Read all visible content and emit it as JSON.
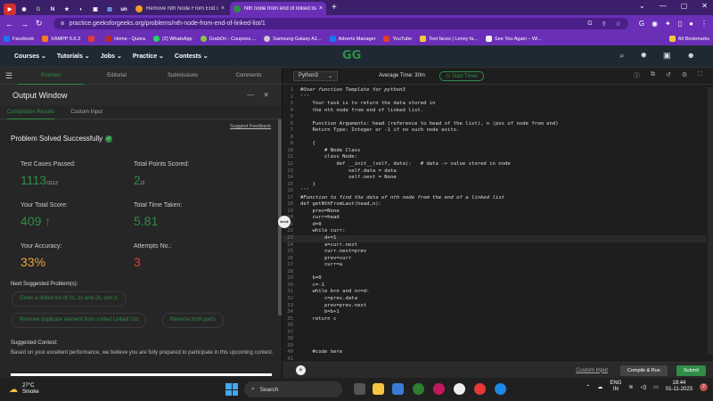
{
  "browser": {
    "tabs": [
      {
        "title": "Remove Nth Node From End of",
        "active": false
      },
      {
        "title": "Nth node from end of linked list",
        "active": true
      }
    ],
    "pinned_icons": [
      "youtube-icon",
      "chrome-icon",
      "gfg-icon",
      "unacademy-icon",
      "bookmark-icon",
      "github-icon",
      "notion-icon",
      "docs-icon",
      "unstop-icon"
    ],
    "url": "practice.geeksforgeeks.org/problems/nth-node-from-end-of-linked-list/1",
    "bookmarks": [
      "Facebook",
      "XAMPP 5.6.3",
      "",
      "Home - Quora",
      "(2) WhatsApp",
      "GrabOn - Coupons,...",
      "Samsung Galaxy A1...",
      "Adverts Manager",
      "YouTube",
      "Text faces | Lenny fa...",
      "See You Again – Wi..."
    ],
    "all_bookmarks": "All Bookmarks"
  },
  "site": {
    "menu": [
      "Courses ⌄",
      "Tutorials ⌄",
      "Jobs ⌄",
      "Practice ⌄",
      "Contests ⌄"
    ],
    "logo": "GG"
  },
  "left_tabs": [
    "Problem",
    "Editorial",
    "Submissions",
    "Comments"
  ],
  "output": {
    "title": "Output Window",
    "tabs": [
      "Compilation Results",
      "Custom Input"
    ],
    "feedback": "Suggest Feedback",
    "status": "Problem Solved Successfully",
    "stats": {
      "tcp_label": "Test Cases Passed:",
      "tcp_value": "1113",
      "tcp_total": "/1113",
      "tps_label": "Total Points Scored:",
      "tps_value": "2",
      "tps_total": "/2",
      "score_label": "Your Total Score:",
      "score_value": "409",
      "time_label": "Total Time Taken:",
      "time_value": "5.81",
      "acc_label": "Your Accuracy:",
      "acc_value": "33%",
      "att_label": "Attempts No.:",
      "att_value": "3"
    },
    "next_label": "Next Suggested Problem(s):",
    "next_problems": [
      "Given a linked list of 0s, 1s and 2s, sort it.",
      "Remove duplicate element from sorted Linked List",
      "Reverse both parts"
    ],
    "contest_heading": "Suggested Contest:",
    "contest_text": "Based on your excellent performance, we believe you are fully prepared to participate in this upcoming contest."
  },
  "editor": {
    "language": "Python3",
    "avg_time": "Average Time: 30m",
    "timer": "Start Timer",
    "code": [
      "#User function Template for python3",
      "'''",
      "    Your task is to return the data stored in",
      "    the nth node from end of linked list.",
      "",
      "    Function Arguments: head (reference to head of the list), n (pos of node from end)",
      "    Return Type: Integer or -1 if no such node exits.",
      "",
      "    {",
      "        # Node Class",
      "        class Node:",
      "            def __init__(self, data):   # data -> value stored in node",
      "                self.data = data",
      "                self.next = None",
      "    }",
      "'''",
      "#Function to find the data of nth node from the end of a linked list",
      "def getNthFromLast(head,n):",
      "    prev=None",
      "    curr=head",
      "    d=0",
      "    while curr:",
      "        d+=1",
      "        a=curr.next",
      "        curr.next=prev",
      "        prev=curr",
      "        curr=a",
      "",
      "    b=0",
      "    c=-1",
      "    while b<n and n<=d:",
      "        c=prev.data",
      "        prev=prev.next",
      "        b=b+1",
      "    return c",
      "",
      "",
      "",
      "",
      "    #code here",
      ""
    ],
    "line_numbers": [
      "1",
      "2",
      "3",
      "4",
      "5",
      "6",
      "7",
      "8",
      "9",
      "10",
      "11",
      "12",
      "13",
      "14",
      "15",
      "16",
      "17",
      "18",
      "19",
      "20",
      "21",
      "22",
      "23",
      "24",
      "25",
      "26",
      "27",
      "28",
      "29",
      "30",
      "31",
      "32",
      "33",
      "34",
      "35",
      "36",
      "37",
      "38",
      "39",
      "40",
      "41"
    ],
    "custom_input": "Custom Input",
    "compile_run": "Compile & Run",
    "submit": "Submit"
  },
  "taskbar": {
    "temp": "27°C",
    "weather": "Smoke",
    "search": "Search",
    "lang1": "ENG",
    "lang2": "IN",
    "time": "18:44",
    "date": "01-11-2023",
    "notifications": "2"
  },
  "colors": {
    "accent": "#2f8d46",
    "browser": "#6a2fb6",
    "accuracy": "#e8a33d",
    "attempts": "#e53935"
  }
}
